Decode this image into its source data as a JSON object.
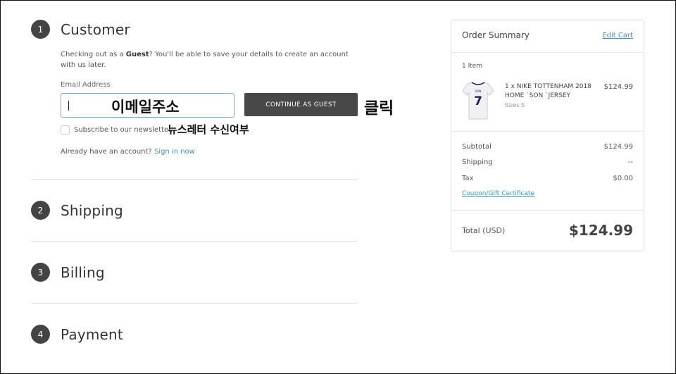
{
  "steps": [
    {
      "num": "1",
      "title": "Customer"
    },
    {
      "num": "2",
      "title": "Shipping"
    },
    {
      "num": "3",
      "title": "Billing"
    },
    {
      "num": "4",
      "title": "Payment"
    }
  ],
  "customer": {
    "guest_prefix": "Checking out as a ",
    "guest_word": "Guest",
    "guest_suffix": "? You'll be able to save your details to create an account with us later.",
    "email_label": "Email Address",
    "email_value": "",
    "continue_label": "CONTINUE AS GUEST",
    "newsletter_label": "Subscribe to our newsletter.",
    "account_text": "Already have an account?",
    "sign_in_label": "Sign in now"
  },
  "annotations": {
    "email": "이메일주소",
    "click": "클릭",
    "newsletter": "뉴스레터 수신여부"
  },
  "summary": {
    "title": "Order Summary",
    "edit_cart": "Edit Cart",
    "item_count": "1 Item",
    "item": {
      "name": "1 x NIKE TOTTENHAM 2018 HOME `SON `JERSEY",
      "size": "Sizes S",
      "price": "$124.99",
      "jersey_name": "SON",
      "jersey_number": "7"
    },
    "rows": [
      {
        "label": "Subtotal",
        "value": "$124.99"
      },
      {
        "label": "Shipping",
        "value": "--"
      },
      {
        "label": "Tax",
        "value": "$0.00"
      }
    ],
    "coupon": "Coupon/Gift Certificate",
    "total_label": "Total (USD)",
    "total_value": "$124.99"
  },
  "colors": {
    "accent_link": "#4d8cb8",
    "button_bg": "#484848",
    "step_circle": "#444444"
  }
}
